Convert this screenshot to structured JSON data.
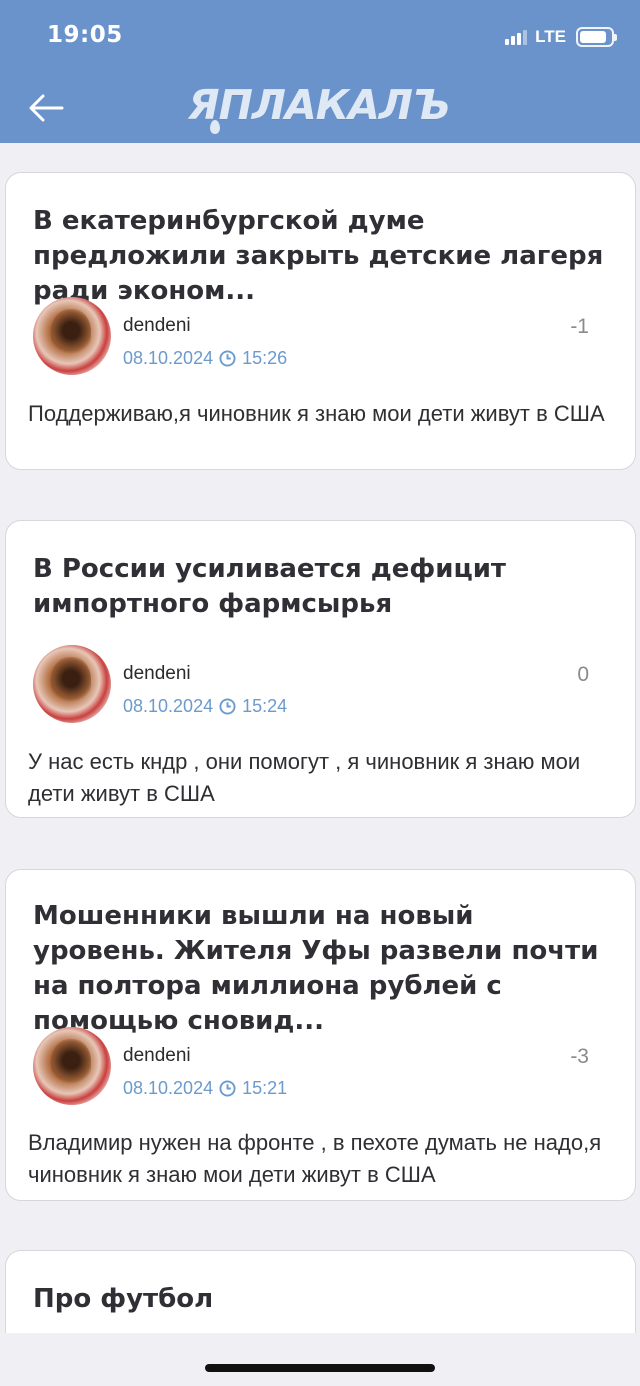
{
  "status_bar": {
    "time": "19:05",
    "network": "LTE",
    "battery_level": 0.85
  },
  "header": {
    "logo_text": "ЯПЛАКАЛЪ",
    "back_icon": "arrow-left-icon"
  },
  "comments": [
    {
      "title": "В екатеринбургской думе предложили закрыть детские лагеря ради эконом...",
      "author": "dendeni",
      "date": "08.10.2024",
      "time": "15:26",
      "rating": "-1",
      "text": "Поддерживаю,я чиновник я знаю мои дети живут в США"
    },
    {
      "title": "В России усиливается дефицит импортного фармсырья",
      "author": "dendeni",
      "date": "08.10.2024",
      "time": "15:24",
      "rating": "0",
      "text": "У нас есть кндр , они помогут , я чиновник я знаю мои дети живут в США"
    },
    {
      "title": "Мошенники вышли на новый уровень. Жителя Уфы развели почти на полтора миллиона рублей с помощью сновид...",
      "author": "dendeni",
      "date": "08.10.2024",
      "time": "15:21",
      "rating": "-3",
      "text": "Владимир нужен на фронте , в пехоте думать не надо,я чиновник я знаю мои дети живут в США"
    },
    {
      "title": "Про футбол"
    }
  ]
}
